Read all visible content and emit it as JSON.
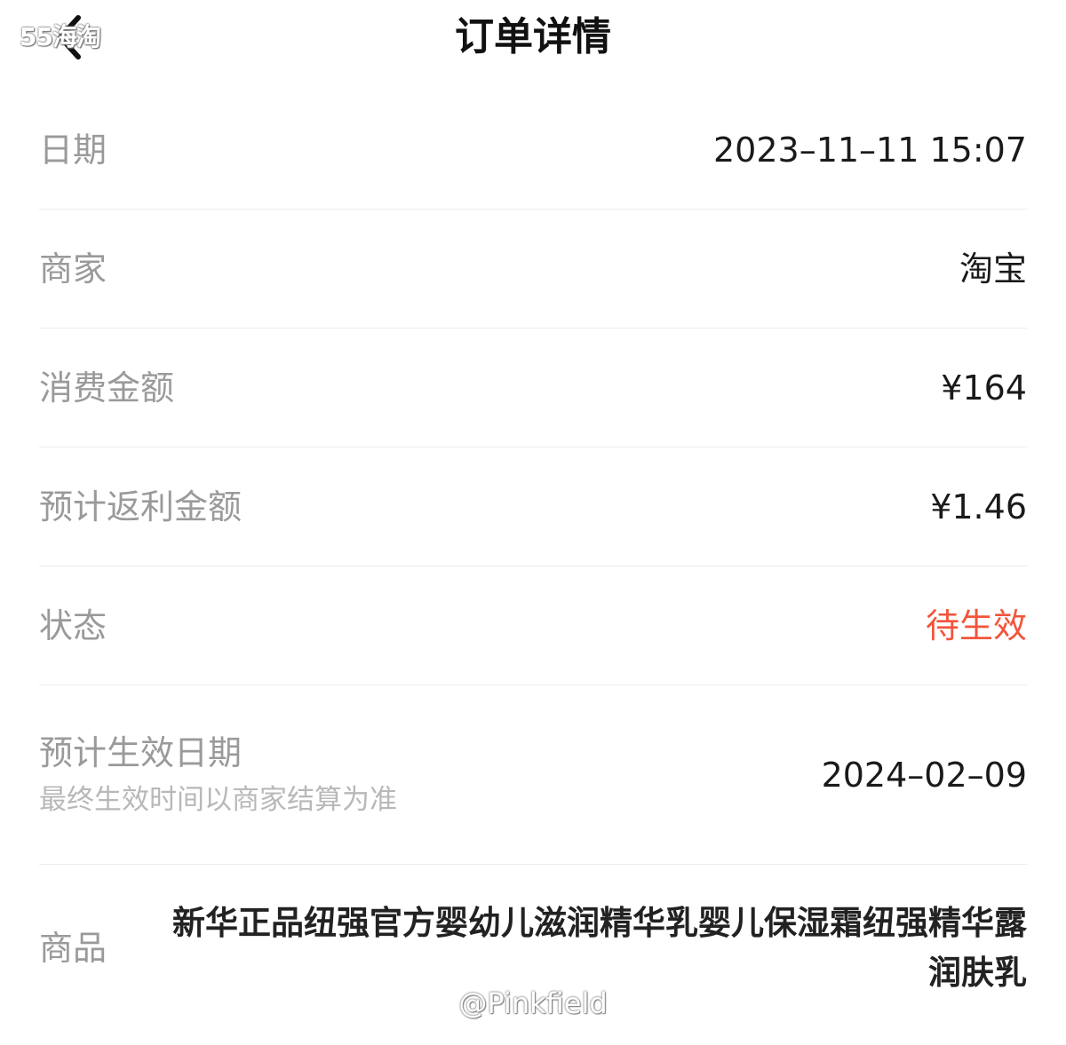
{
  "header": {
    "title": "订单详情",
    "back_icon": "chevron-left-icon",
    "watermark": "55海淘"
  },
  "rows": [
    {
      "label": "日期",
      "value": "2023–11–11 15:07"
    },
    {
      "label": "商家",
      "value": "淘宝"
    },
    {
      "label": "消费金额",
      "value": "¥164"
    },
    {
      "label": "预计返利金额",
      "value": "¥1.46"
    },
    {
      "label": "状态",
      "value": "待生效"
    },
    {
      "label": "预计生效日期",
      "sublabel": "最终生效时间以商家结算为准",
      "value": "2024–02–09"
    },
    {
      "label": "商品",
      "value": "新华正品纽强官方婴幼儿滋润精华乳婴儿保湿霜纽强精华露润肤乳"
    }
  ],
  "colors": {
    "status": "#f2553b",
    "label": "#9a9a9a",
    "sublabel": "#b8b8b8",
    "value": "#1a1a1a",
    "divider": "#ececec"
  },
  "footer_watermark": "@Pinkfield"
}
